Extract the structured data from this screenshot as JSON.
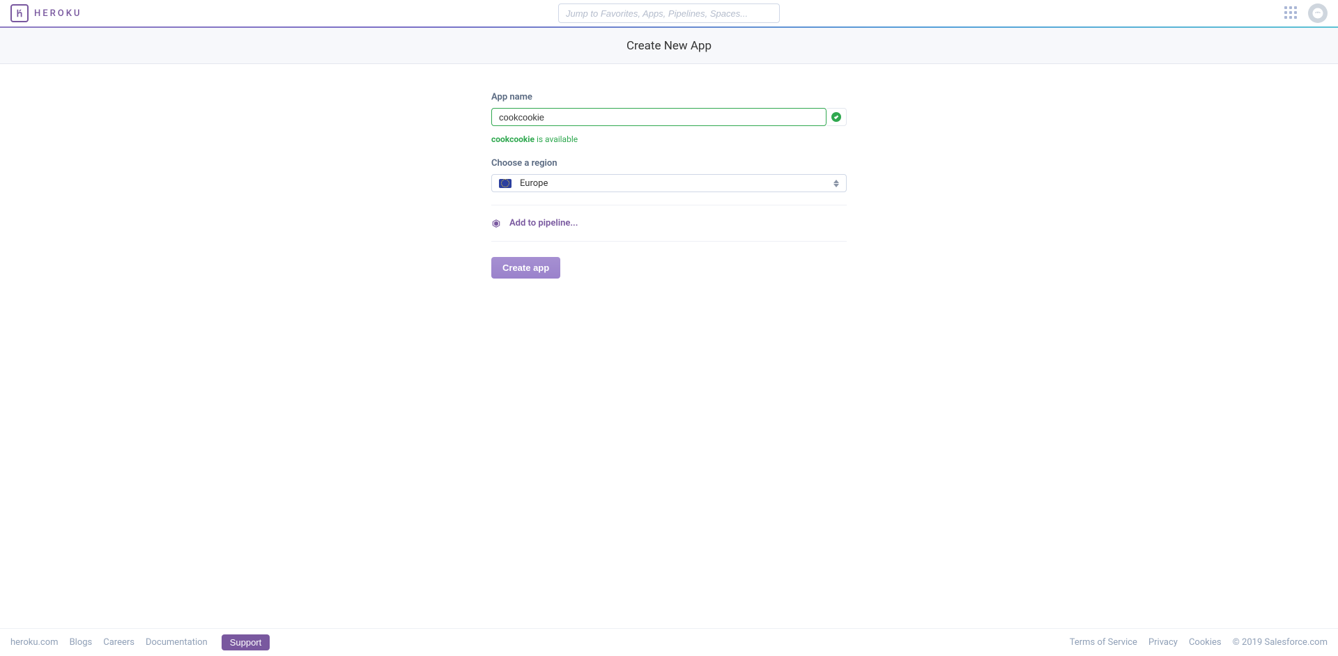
{
  "topbar": {
    "brand": "HEROKU",
    "search_placeholder": "Jump to Favorites, Apps, Pipelines, Spaces..."
  },
  "header": {
    "title": "Create New App"
  },
  "form": {
    "app_name_label": "App name",
    "app_name_value": "cookcookie",
    "avail_name": "cookcookie",
    "avail_suffix": " is available",
    "region_label": "Choose a region",
    "region_value": "Europe",
    "pipeline_label": "Add to pipeline...",
    "submit_label": "Create app"
  },
  "footer": {
    "left": [
      "heroku.com",
      "Blogs",
      "Careers",
      "Documentation"
    ],
    "support": "Support",
    "right": [
      "Terms of Service",
      "Privacy",
      "Cookies"
    ],
    "copyright": "© 2019 Salesforce.com"
  }
}
